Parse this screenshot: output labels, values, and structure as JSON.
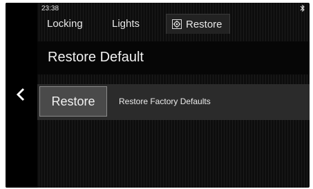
{
  "status": {
    "time": "23:38"
  },
  "tabs": [
    {
      "label": "Locking",
      "active": false
    },
    {
      "label": "Lights",
      "active": false
    },
    {
      "label": "Restore",
      "active": true,
      "icon": "restore-gear-icon"
    }
  ],
  "section": {
    "title": "Restore Default"
  },
  "restore": {
    "button_label": "Restore",
    "description": "Restore Factory Defaults"
  },
  "icons": {
    "back": "chevron-left-icon",
    "bluetooth": "bluetooth-icon"
  },
  "colors": {
    "background": "#111111",
    "row": "#2b2b2b",
    "button": "#4a4a4a",
    "text": "#f0f0f0"
  }
}
